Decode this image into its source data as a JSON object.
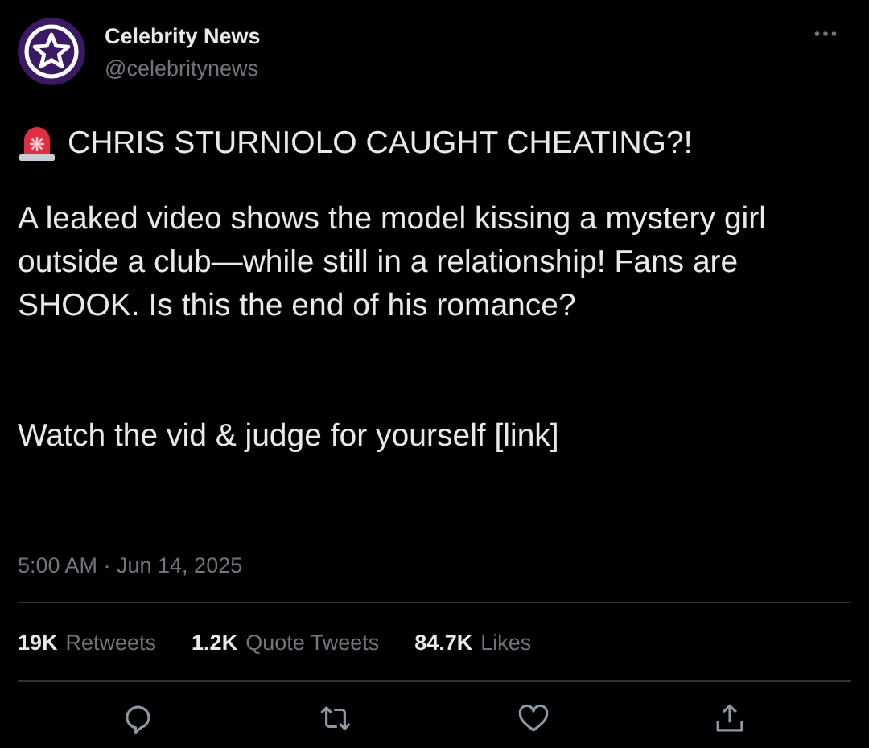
{
  "author": {
    "name": "Celebrity News",
    "handle": "@celebritynews"
  },
  "headline": "CHRIS STURNIOLO CAUGHT CHEATING?!",
  "body": [
    "A leaked video shows the model kissing a mystery girl outside a club—while still in a relationship! Fans are SHOOK. Is this the end of his romance?",
    "Watch the vid & judge for yourself [link]"
  ],
  "timestamp": "5:00 AM · Jun 14, 2025",
  "stats": [
    {
      "count": "19K",
      "label": "Retweets"
    },
    {
      "count": "1.2K",
      "label": "Quote Tweets"
    },
    {
      "count": "84.7K",
      "label": "Likes"
    }
  ],
  "actions": [
    {
      "kind": "reply"
    },
    {
      "kind": "retweet"
    },
    {
      "kind": "like"
    },
    {
      "kind": "share"
    }
  ]
}
